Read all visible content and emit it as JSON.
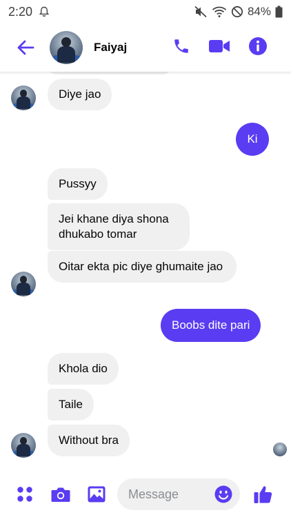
{
  "status_bar": {
    "time": "2:20",
    "battery": "84%",
    "icons": [
      "bell-icon",
      "mute-icon",
      "wifi-icon",
      "dnd-icon",
      "battery-icon"
    ]
  },
  "header": {
    "contact_name": "Faiyaj",
    "icons": [
      "back-arrow-icon",
      "phone-icon",
      "video-camera-icon",
      "info-icon"
    ]
  },
  "messages": [
    {
      "side": "in",
      "text": "Diye jao"
    },
    {
      "side": "out",
      "text": "Ki"
    },
    {
      "side": "in",
      "text": "Pussyy"
    },
    {
      "side": "in",
      "text": "Jei khane diya shona dhukabo tomar"
    },
    {
      "side": "in",
      "text": "Oitar ekta pic diye ghumaite jao"
    },
    {
      "side": "out",
      "text": "Boobs dite pari"
    },
    {
      "side": "in",
      "text": "Khola dio"
    },
    {
      "side": "in",
      "text": "Taile"
    },
    {
      "side": "in",
      "text": "Without bra"
    }
  ],
  "composer": {
    "placeholder": "Message",
    "icons": [
      "apps-grid-icon",
      "camera-icon",
      "gallery-icon",
      "emoji-icon",
      "thumbs-up-icon"
    ]
  },
  "colors": {
    "accent": "#5a3cf2",
    "incoming_bubble": "#f0f0f0",
    "outgoing_bubble": "#5a3cf2"
  }
}
